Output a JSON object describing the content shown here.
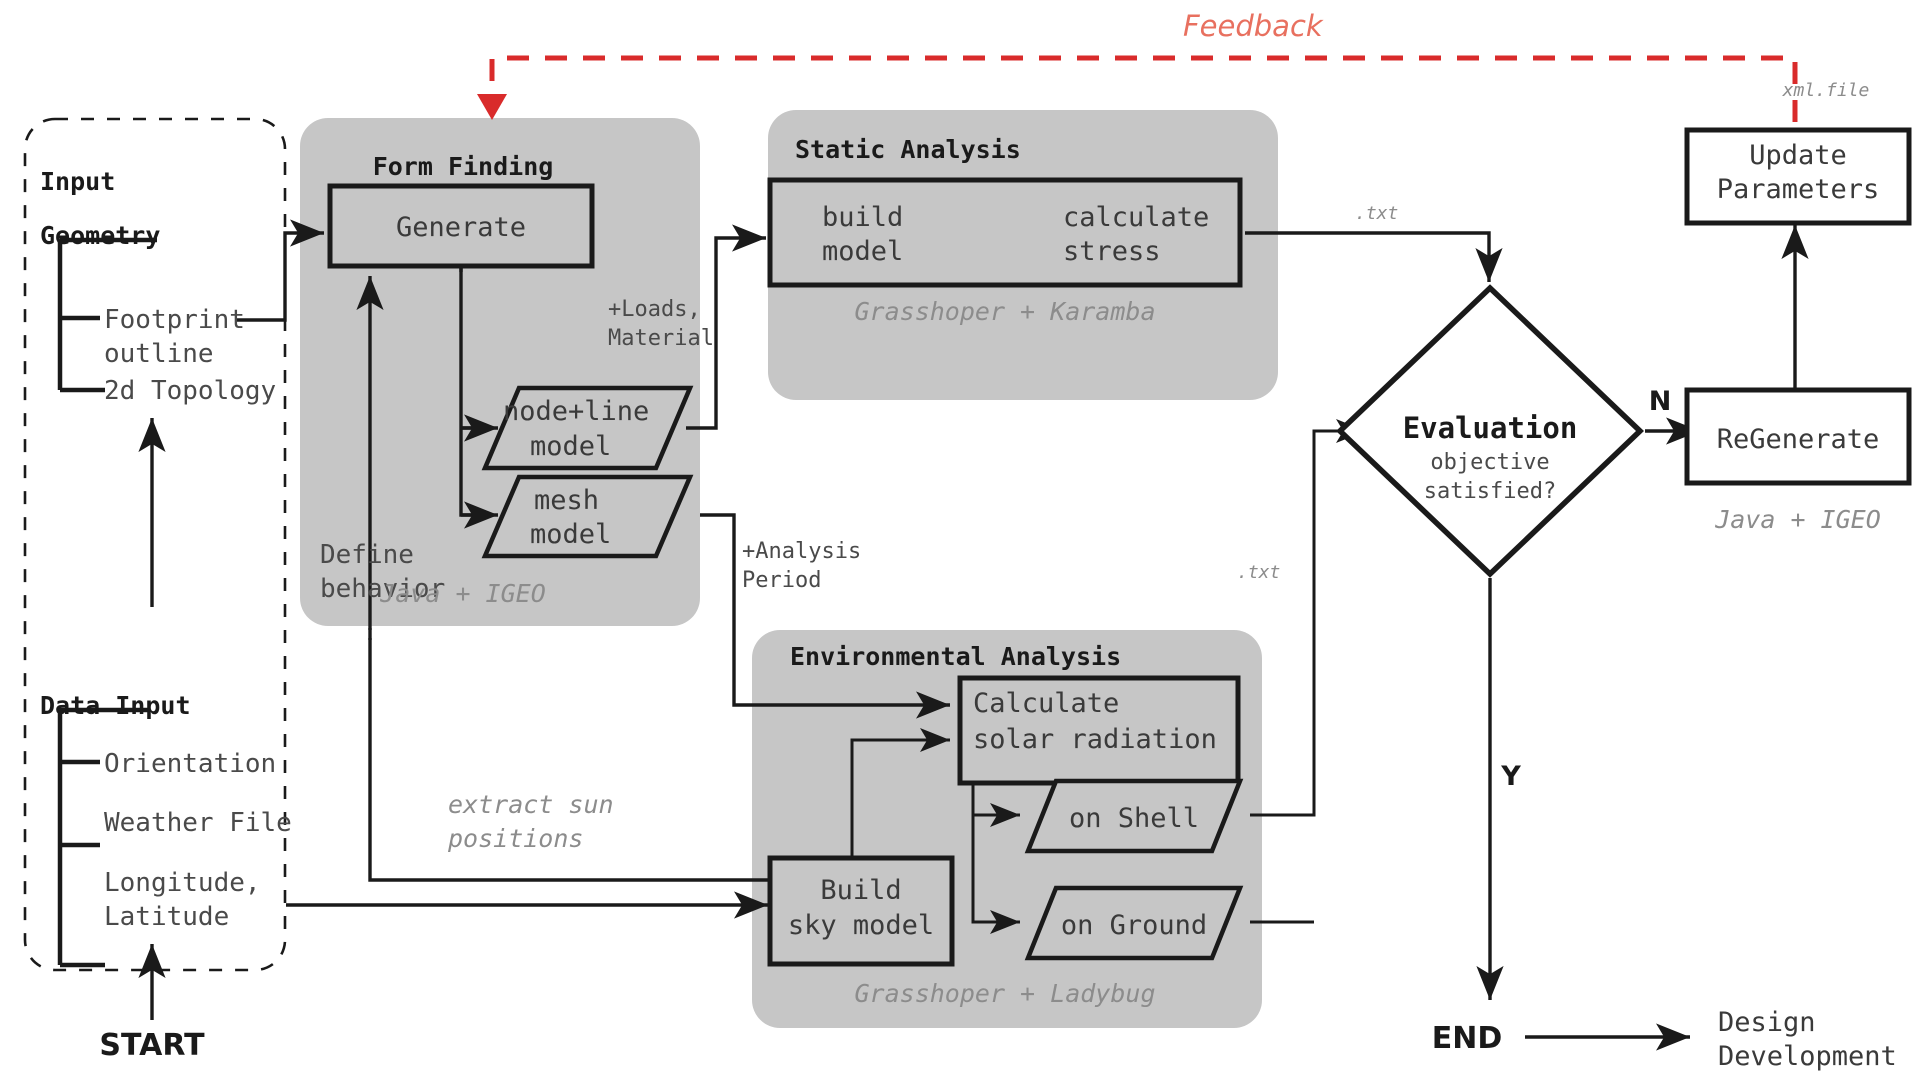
{
  "diagram": {
    "title": "Computational design workflow flowchart",
    "colors": {
      "panel_fill": "#c6c6c6",
      "stroke": "#1a1a1a",
      "feedback_red": "#d92b2b",
      "feedback_text": "#e8705f",
      "muted_text": "#8c8c8c",
      "body_text": "#3a3a3a",
      "background": "#ffffff"
    }
  },
  "feedback": {
    "label": "Feedback",
    "file_note": "xml.file"
  },
  "input_panel": {
    "title": "Input",
    "groups": [
      {
        "heading": "Geometry",
        "items": [
          "Footprint\noutline",
          "2d Topology"
        ],
        "items_flat": [
          {
            "line1": "Footprint",
            "line2": "outline"
          },
          {
            "line1": "2d Topology",
            "line2": ""
          }
        ]
      },
      {
        "heading": "Data Input",
        "items_flat": [
          {
            "line1": "Orientation",
            "line2": ""
          },
          {
            "line1": "Weather File",
            "line2": ""
          },
          {
            "line1": "Longitude,",
            "line2": "Latitude"
          }
        ]
      }
    ]
  },
  "form_finding": {
    "title": "Form Finding",
    "generate_label": "Generate",
    "define_behavior": {
      "line1": "Define",
      "line2": "behavior"
    },
    "outputs": [
      {
        "line1": "node+line",
        "line2": "model"
      },
      {
        "line1": "mesh",
        "line2": "model"
      }
    ],
    "tool": "Java + IGEO"
  },
  "static_analysis": {
    "title": "Static Analysis",
    "steps": [
      {
        "line1": "build",
        "line2": "model"
      },
      {
        "line1": "calculate",
        "line2": "stress"
      }
    ],
    "tool": "Grasshoper + Karamba",
    "input_note": {
      "line1": "+Loads,",
      "line2": "Material"
    },
    "output_note": ".txt"
  },
  "environmental_analysis": {
    "title": "Environmental Analysis",
    "calculate": {
      "line1": "Calculate",
      "line2": "solar radiation"
    },
    "sky_model": {
      "line1": "Build",
      "line2": "sky model"
    },
    "outputs": [
      "on Shell",
      "on Ground"
    ],
    "tool": "Grasshoper + Ladybug",
    "input_note": {
      "line1": "+Analysis",
      "line2": "Period"
    },
    "extract_note": {
      "line1": "extract sun",
      "line2": "positions"
    },
    "output_note": ".txt"
  },
  "evaluation": {
    "title": "Evaluation",
    "subtitle": {
      "line1": "objective",
      "line2": "satisfied?"
    },
    "branch_no": "N",
    "branch_yes": "Y"
  },
  "regenerate": {
    "label": "ReGenerate",
    "tool": "Java + IGEO"
  },
  "update_parameters": {
    "line1": "Update",
    "line2": "Parameters"
  },
  "terminals": {
    "start": "START",
    "end": "END",
    "next_phase": {
      "line1": "Design",
      "line2": "Development"
    }
  }
}
